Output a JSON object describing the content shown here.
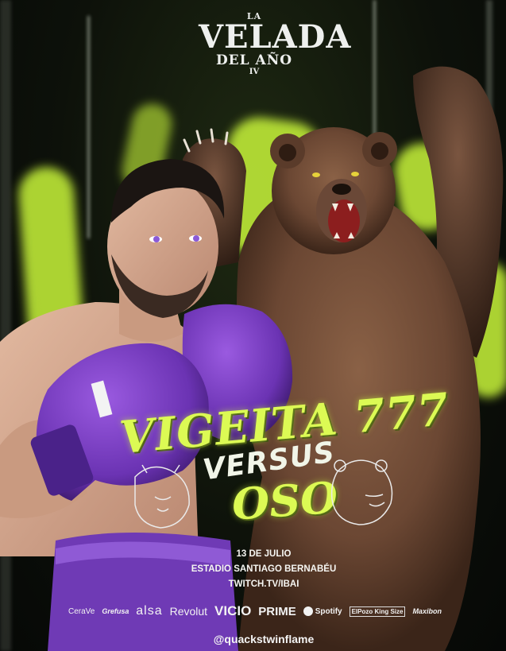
{
  "logo": {
    "line1": "LA",
    "line2": "VELADA",
    "line3": "DEL AÑO",
    "line4": "IV"
  },
  "fighters": {
    "left": "VIGEITA 777",
    "versus": "VERSUS",
    "right": "OSO"
  },
  "event": {
    "date": "13 DE JULIO",
    "venue": "ESTADIO SANTIAGO BERNABÉU",
    "stream": "TWITCH.TV/IBAI"
  },
  "sponsors": [
    "CeraVe",
    "Grefusa",
    "alsa",
    "Revolut",
    "VICIO",
    "PRIME",
    "Spotify",
    "ElPozo King Size",
    "Maxibon"
  ],
  "handle": "@quackstwinflame",
  "colors": {
    "accent": "#dcfa54",
    "glove": "#7a3fc4",
    "background": "#0b0d0a"
  }
}
